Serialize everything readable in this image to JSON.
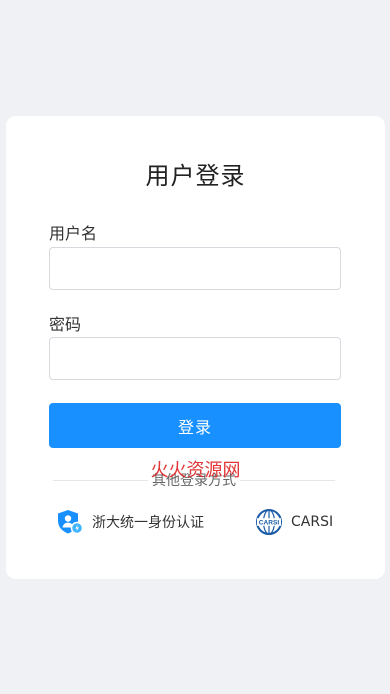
{
  "login": {
    "title": "用户登录",
    "username_label": "用户名",
    "username_value": "",
    "password_label": "密码",
    "password_value": "",
    "submit_label": "登录"
  },
  "other_login": {
    "divider_text": "其他登录方式",
    "options": [
      {
        "label": "浙大统一身份认证",
        "icon": "shield-user-icon"
      },
      {
        "label": "CARSI",
        "icon": "carsi-globe-icon"
      }
    ]
  },
  "watermark": "火火资源网",
  "colors": {
    "page_bg": "#f0f1f5",
    "card_bg": "#ffffff",
    "primary": "#1890ff",
    "watermark": "#e02020"
  }
}
